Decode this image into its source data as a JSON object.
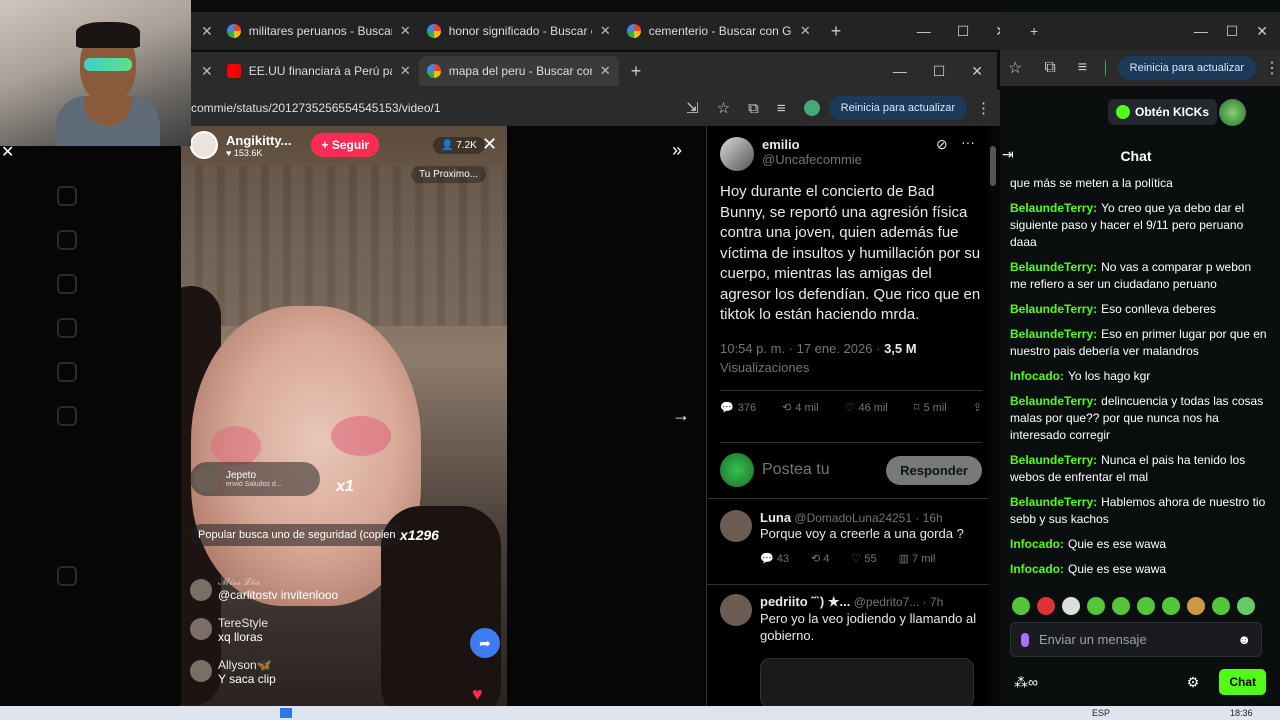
{
  "tabs_row1": [
    {
      "title": "militares peruanos - Buscar con Google",
      "icon": "google-icon"
    },
    {
      "title": "honor significado - Buscar con Google",
      "icon": "google-icon"
    },
    {
      "title": "cementerio - Buscar con Google",
      "icon": "google-icon"
    }
  ],
  "tabs_row2": [
    {
      "title": "EE.UU financiará a Perú para equipos",
      "icon": "youtube-icon"
    },
    {
      "title": "mapa del peru - Buscar con Google",
      "icon": "google-icon"
    }
  ],
  "browser": {
    "url": "commie/status/2012735256554545153/video/1",
    "update_label": "Reinicia para actualizar"
  },
  "tiktok": {
    "username": "Angikitty...",
    "likes": "153.6K",
    "follow_label": "+ Seguir",
    "viewers": "7.2K",
    "next_label": "Tu Proximo...",
    "gift_user": "Jepeto",
    "gift_text": "envió Saludos d...",
    "gift_count": "x1",
    "popular_label": "Popular",
    "popular_text": "busca uno de seguridad (copien",
    "popular_count": "x1296",
    "ghost_user": "𝓜𝓲𝓼𝓼 𝓛𝓲𝓪",
    "comments": [
      {
        "user": "",
        "text": "@carlitostv invitenlooo"
      },
      {
        "user": "TereStyle",
        "text": "xq lloras"
      },
      {
        "user": "Allyson🦋",
        "text": "Y saca clip"
      }
    ]
  },
  "tweet": {
    "name": "emilio",
    "handle": "@Uncafecommie",
    "text": "Hoy durante el concierto de Bad Bunny, se reportó una agresión física contra una joven, quien además fue víctima de insultos y humillación por su cuerpo, mientras las amigas del agresor los defendían. Que rico que en tiktok lo están haciendo mrda.",
    "time": "10:54 p. m. · 17 ene. 2026 ·",
    "views": "3,5 M",
    "views_label": "Visualizaciones",
    "stats": {
      "replies": "376",
      "retweets": "4 mil",
      "likes": "46 mil",
      "bookmarks": "5 mil"
    },
    "reply_placeholder": "Postea tu",
    "reply_button": "Responder"
  },
  "replies": [
    {
      "name": "Luna",
      "handle": "@DomadoLuna24251 · 16h",
      "text": "Porque voy a creerle a una gorda ?",
      "stats": [
        "43",
        "4",
        "55",
        "7 mil"
      ]
    },
    {
      "name": "pedriito ˜`) ★...",
      "handle": "@pedrito7... · 7h",
      "text": "Pero yo la veo jodiendo y llamando al gobierno."
    }
  ],
  "kick": {
    "get_kicks": "Obtén KICKs",
    "chat_title": "Chat",
    "partial_message": "que más se meten a la política",
    "messages": [
      {
        "user": "BelaundeTerry:",
        "text": "Yo creo que ya debo dar el siguiente paso y hacer el 9/11 pero peruano daaa",
        "color": "#53fc18"
      },
      {
        "user": "BelaundeTerry:",
        "text": "No vas a comparar p webon me refiero a ser un ciudadano peruano",
        "color": "#53fc18"
      },
      {
        "user": "BelaundeTerry:",
        "text": "Eso conlleva deberes",
        "color": "#53fc18"
      },
      {
        "user": "BelaundeTerry:",
        "text": "Eso en primer lugar por que en nuestro pais debería ver malandros",
        "color": "#53fc18"
      },
      {
        "user": "Infocado:",
        "text": "Yo los hago kgr",
        "color": "#53fc18"
      },
      {
        "user": "BelaundeTerry:",
        "text": "delincuencia y todas las cosas malas por que?? por que nunca nos ha interesado corregir",
        "color": "#53fc18"
      },
      {
        "user": "BelaundeTerry:",
        "text": "Nunca el pais ha tenido los webos de enfrentar el mal",
        "color": "#53fc18"
      },
      {
        "user": "BelaundeTerry:",
        "text": "Hablemos ahora de nuestro tio sebb y sus kachos",
        "color": "#53fc18"
      },
      {
        "user": "Infocado:",
        "text": "Quie es ese wawa",
        "color": "#53fc18"
      },
      {
        "user": "Infocado:",
        "text": "Quie es ese wawa",
        "color": "#53fc18"
      }
    ],
    "input_placeholder": "Enviar un mensaje",
    "send_label": "Chat",
    "update_label": "Reinicia para actualizar"
  },
  "taskbar": {
    "lang": "ESP",
    "time": "18:36"
  }
}
